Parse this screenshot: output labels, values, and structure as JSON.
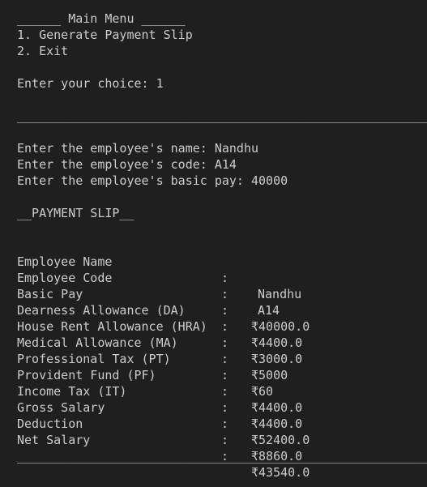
{
  "terminal": {
    "menu_title": "______ Main Menu ______",
    "menu_options": [
      "1. Generate Payment Slip",
      "2. Exit"
    ],
    "choice_prompt": "Enter your choice: 1",
    "separator": "________________________________________________________________________________",
    "inputs": [
      "Enter the employee's name: Nandhu",
      "Enter the employee's code: A14",
      "Enter the employee's basic pay: 40000"
    ],
    "slip_title": "__PAYMENT SLIP__",
    "slip_rows": [
      {
        "label": "Employee Name",
        "colon": ":",
        "value": "Nandhu"
      },
      {
        "label": "Employee Code",
        "colon": ":",
        "value": "A14"
      },
      {
        "label": "Basic Pay",
        "colon": ":",
        "value": "₹40000.0"
      },
      {
        "label": "Dearness Allowance (DA)",
        "colon": ":",
        "value": "₹4400.0"
      },
      {
        "label": "House Rent Allowance (HRA)",
        "colon": ":",
        "value": "₹3000.0"
      },
      {
        "label": "Medical Allowance (MA)",
        "colon": ":",
        "value": "₹5000"
      },
      {
        "label": "Professional Tax (PT)",
        "colon": ":",
        "value": "₹60"
      },
      {
        "label": "Provident Fund (PF)",
        "colon": ":",
        "value": "₹4400.0"
      },
      {
        "label": "Income Tax (IT)",
        "colon": ":",
        "value": "₹4400.0"
      },
      {
        "label": "Gross Salary",
        "colon": ":",
        "value": "₹52400.0"
      },
      {
        "label": "Deduction",
        "colon": ":",
        "value": "₹8860.0"
      },
      {
        "label": "Net Salary",
        "colon": ":",
        "value": "₹43540.0"
      }
    ]
  }
}
